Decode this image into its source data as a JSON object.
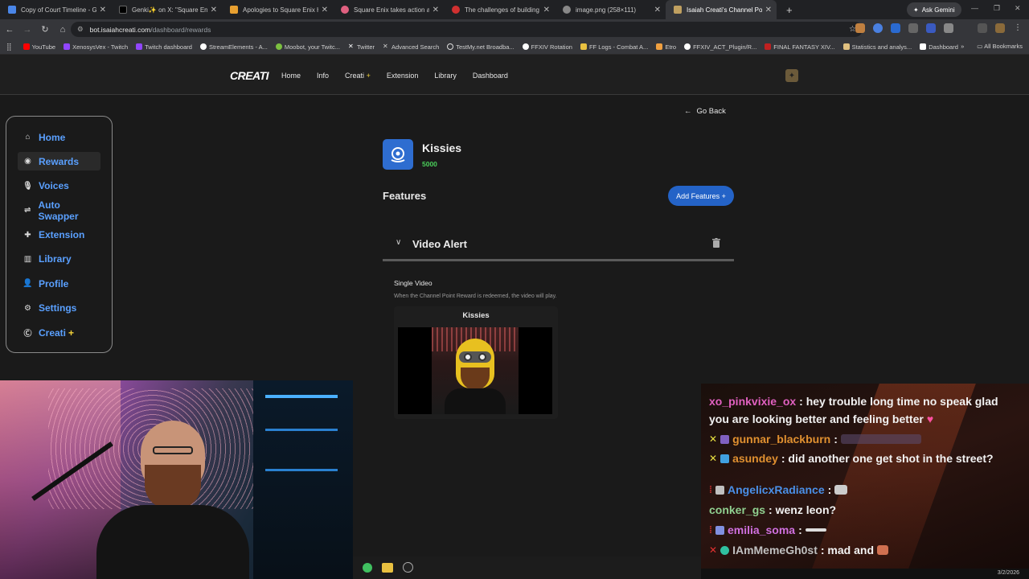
{
  "browser": {
    "tabs": [
      {
        "label": "Copy of Court Timeline - Goog",
        "color": "#4a86e8"
      },
      {
        "label": "Genki✨ on X: \"Square Enix ha",
        "color": "#000000"
      },
      {
        "label": "Apologies to Square Enix Holdi",
        "color": "#e8a030"
      },
      {
        "label": "Square Enix takes action again",
        "color": "#e06080"
      },
      {
        "label": "The challenges of building a so",
        "color": "#d03030"
      },
      {
        "label": "image.png (258×111)",
        "color": "#888888"
      },
      {
        "label": "Isaiah Creati's Channel Point Re",
        "color": "#c0a060",
        "active": true
      }
    ],
    "new_tab": "+",
    "ask_gemini": "Ask Gemini",
    "url_domain": "bot.isaiahcreati.com",
    "url_path": "/dashboard/rewards",
    "bookmarks": [
      {
        "label": "YouTube",
        "color": "#ff0000"
      },
      {
        "label": "XenosysVex - Twitch",
        "color": "#9146ff"
      },
      {
        "label": "Twitch dashboard",
        "color": "#9146ff"
      },
      {
        "label": "StreamElements - A...",
        "color": "#ffffff"
      },
      {
        "label": "Moobot, your Twitc...",
        "color": "#7cc040"
      },
      {
        "label": "Twitter",
        "color": "#ffffff"
      },
      {
        "label": "Advanced Search",
        "color": "#cccccc"
      },
      {
        "label": "TestMy.net Broadba...",
        "color": "#dddddd"
      },
      {
        "label": "FFXIV Rotation",
        "color": "#ffffff"
      },
      {
        "label": "FF Logs - Combat A...",
        "color": "#e8c040"
      },
      {
        "label": "Etro",
        "color": "#f0a040"
      },
      {
        "label": "FFXIV_ACT_Plugin/R...",
        "color": "#ffffff"
      },
      {
        "label": "FINAL FANTASY XIV...",
        "color": "#c02020"
      },
      {
        "label": "Statistics and analys...",
        "color": "#e0c080"
      },
      {
        "label": "Dashboard",
        "color": "#ffffff"
      }
    ],
    "all_bookmarks": "All Bookmarks"
  },
  "site": {
    "logo": "CREATI",
    "nav": [
      "Home",
      "Info",
      "Creati",
      "Extension",
      "Library",
      "Dashboard"
    ],
    "nav_plus": "+"
  },
  "sidebar": {
    "items": [
      {
        "label": "Home",
        "icon": "home-icon"
      },
      {
        "label": "Rewards",
        "icon": "rewards-icon",
        "active": true
      },
      {
        "label": "Voices",
        "icon": "mic-icon"
      },
      {
        "label": "Auto Swapper",
        "icon": "swap-icon"
      },
      {
        "label": "Extension",
        "icon": "puzzle-icon"
      },
      {
        "label": "Library",
        "icon": "library-icon"
      },
      {
        "label": "Profile",
        "icon": "profile-icon"
      },
      {
        "label": "Settings",
        "icon": "gear-icon"
      },
      {
        "label": "Creati",
        "icon": "creati-icon"
      }
    ],
    "creati_plus": "+"
  },
  "main": {
    "go_back": "Go Back",
    "reward_name": "Kissies",
    "reward_cost": "5000",
    "features_title": "Features",
    "add_features": "Add Features +",
    "feature": {
      "title": "Video Alert",
      "type": "Single Video",
      "description": "When the Channel Point Reward is redeemed, the video will play.",
      "video_title": "Kissies"
    }
  },
  "chat": {
    "messages": [
      {
        "user": "xo_pinkvixie_ox",
        "color": "#e060c0",
        "text": ": hey trouble long time no speak glad"
      },
      {
        "user": "",
        "color": "#ffffff",
        "text": "you are looking better and feeling better"
      },
      {
        "user": "gunnar_blackburn",
        "color": "#e09030",
        "text": ":"
      },
      {
        "user": "asundey",
        "color": "#e09030",
        "text": ": did another one get shot in the street?"
      },
      {
        "user": "AngelicxRadiance",
        "color": "#4a90e8",
        "text": ":"
      },
      {
        "user": "conker_gs",
        "color": "#90d090",
        "text": ": wenz leon?"
      },
      {
        "user": "emilia_soma",
        "color": "#d070e0",
        "text": ":"
      },
      {
        "user": "IAmMemeGh0st",
        "color": "#c0c0c0",
        "text": ": mad and"
      }
    ]
  },
  "taskbar": {
    "date": "3/2/2026"
  }
}
